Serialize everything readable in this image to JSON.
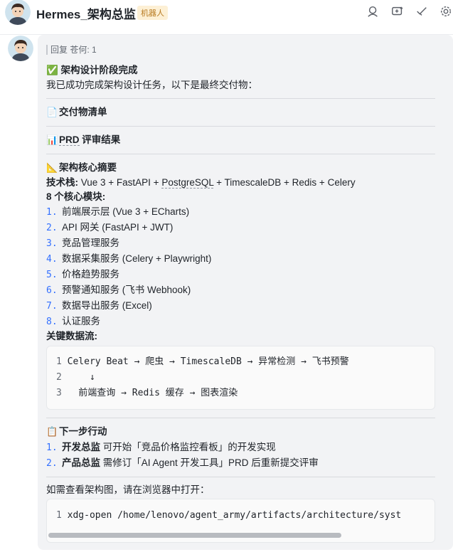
{
  "header": {
    "title": "Hermes_架构总监",
    "badge": "机器人",
    "icons": [
      "search-user-icon",
      "add-chat-icon",
      "check-icon",
      "settings-icon"
    ]
  },
  "message": {
    "quote": "回复 苍何: 1",
    "heading": "✅ 架构设计阶段完成",
    "intro": "我已成功完成架构设计任务，以下是最终交付物：",
    "deliverables": "交付物清单",
    "prd_prefix": "PRD",
    "prd_suffix": " 评审结果",
    "summary": "架构核心摘要",
    "stack_label": "技术栈: ",
    "stack_1": "Vue 3 + FastAPI + ",
    "stack_pg": "PostgreSQL",
    "stack_2": " + TimescaleDB + Redis + Celery",
    "modules_label": "8 个核心模块:",
    "modules": [
      {
        "n": "1.",
        "pre": "前端展示层 (Vue 3 + ECharts)"
      },
      {
        "n": "2.",
        "pre": "API 网关 (FastAPI + JWT)"
      },
      {
        "n": "3.",
        "pre": "竞品管理服务"
      },
      {
        "n": "4.",
        "pre": "数据采集服务 (Celery + Playwright)"
      },
      {
        "n": "5.",
        "pre": "价格趋势服务"
      },
      {
        "n": "6.",
        "pre": "预警通知服务 (飞书 Webhook)"
      },
      {
        "n": "7.",
        "pre": "数据导出服务 (Excel)"
      },
      {
        "n": "8.",
        "pre": "认证服务"
      }
    ],
    "flow_label": "关键数据流:",
    "flow_code": [
      {
        "n": "1",
        "text": " Celery Beat → 爬虫 → TimescaleDB → 异常检测 → 飞书预警"
      },
      {
        "n": "2",
        "text": "     ↓"
      },
      {
        "n": "3",
        "text": "   前端查询 → Redis 缓存 → 图表渲染"
      }
    ],
    "next_label": "下一步行动",
    "next_items": [
      {
        "n": "1.",
        "who": "开发总监",
        "text": " 可开始「竞品价格监控看板」的开发实现"
      },
      {
        "n": "2.",
        "who": "产品总监",
        "text": " 需修订「AI Agent 开发工具」PRD 后重新提交评审"
      }
    ],
    "open_hint": "如需查看架构图，请在浏览器中打开：",
    "open_code": {
      "n": "1",
      "text": " xdg-open /home/lenovo/agent_army/artifacts/architecture/syst"
    }
  }
}
